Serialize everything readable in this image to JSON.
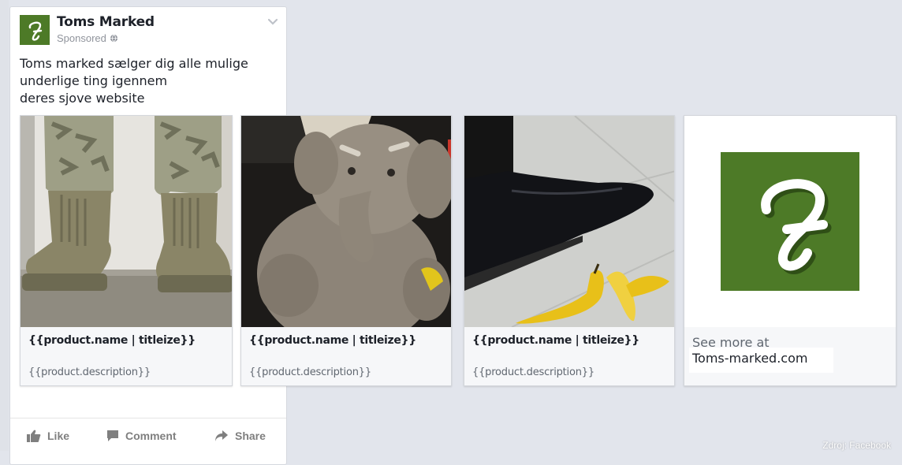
{
  "post": {
    "page_name": "Toms Marked",
    "sponsored_label": "Sponsored",
    "body_lines": [
      "Toms marked sælger dig alle mulige",
      "underlige ting igennem",
      "deres sjove website"
    ]
  },
  "carousel": {
    "cards": [
      {
        "image": "military-boots-photo",
        "name": "{{product.name | titleize}}",
        "description": "{{product.description}}"
      },
      {
        "image": "teddy-elephant-photo",
        "name": "{{product.name | titleize}}",
        "description": "{{product.description}}"
      },
      {
        "image": "shoe-banana-photo",
        "name": "{{product.name | titleize}}",
        "description": "{{product.description}}"
      }
    ],
    "end_card": {
      "see_more_label": "See more at",
      "url": "Toms-marked.com"
    }
  },
  "actions": {
    "like_label": "Like",
    "comment_label": "Comment",
    "share_label": "Share"
  },
  "credit": "Zdroj: Facebook",
  "colors": {
    "brand_green": "#4d7a27",
    "background": "#e2e5ec",
    "action_gray": "#7f7f7f"
  },
  "icons": [
    "globe-icon",
    "chevron-down-icon",
    "like-icon",
    "comment-icon",
    "share-icon"
  ]
}
